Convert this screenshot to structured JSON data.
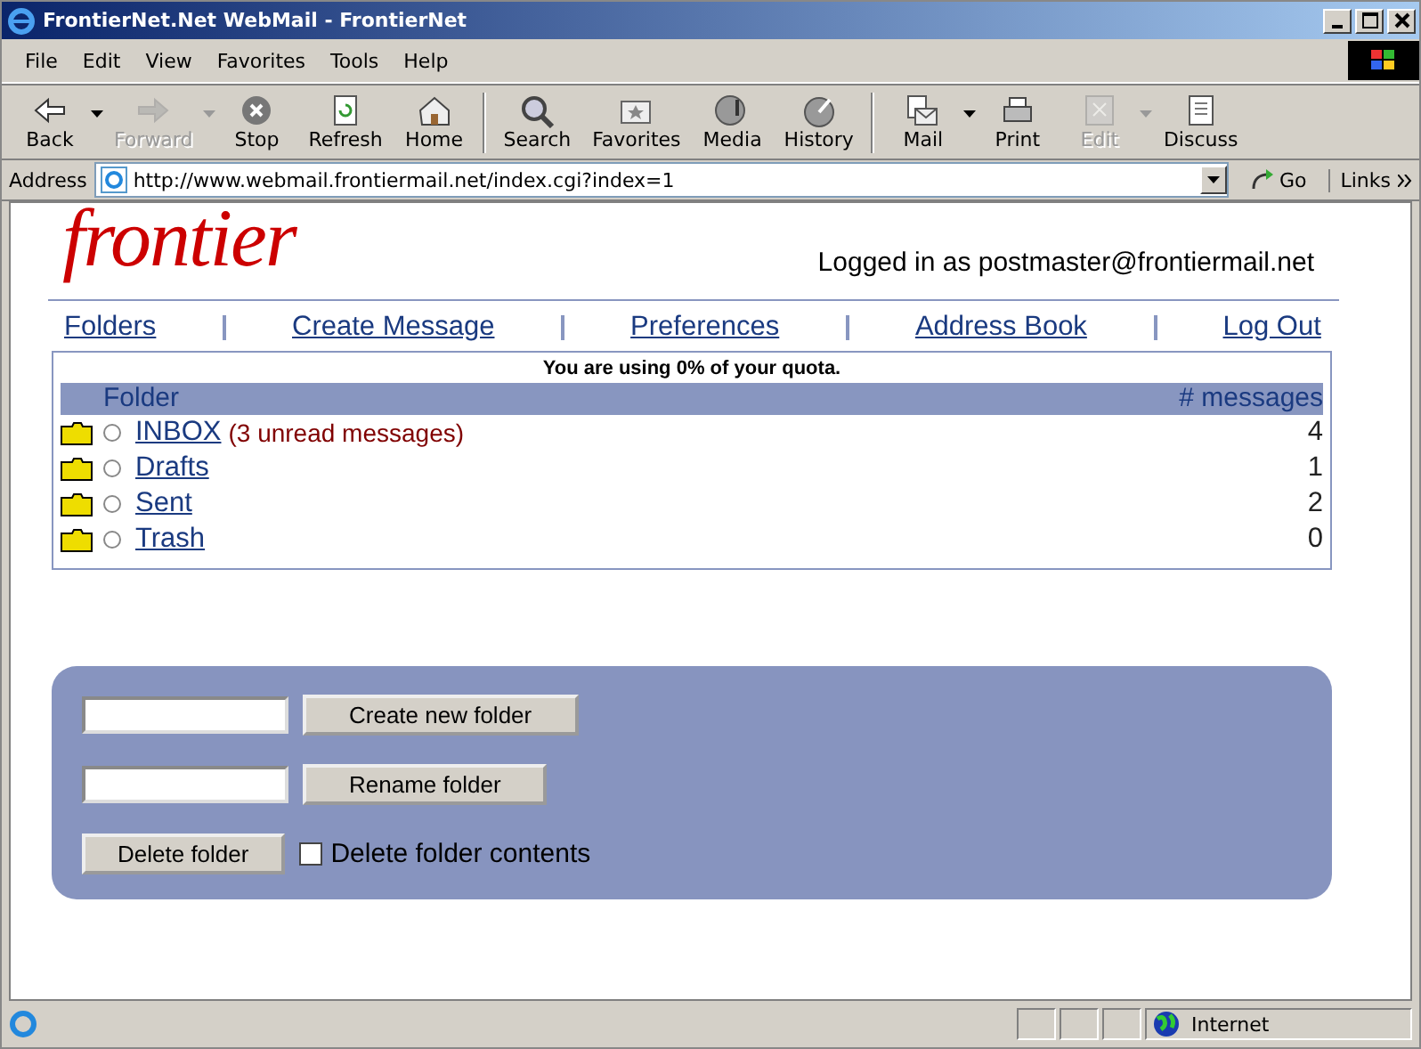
{
  "window": {
    "title": "FrontierNet.Net WebMail - FrontierNet"
  },
  "menu": [
    "File",
    "Edit",
    "View",
    "Favorites",
    "Tools",
    "Help"
  ],
  "toolbar": [
    [
      {
        "label": "Back",
        "disabled": false,
        "dropdown": true
      },
      {
        "label": "Forward",
        "disabled": true,
        "dropdown": true
      },
      {
        "label": "Stop",
        "disabled": false,
        "dropdown": false
      },
      {
        "label": "Refresh",
        "disabled": false,
        "dropdown": false
      },
      {
        "label": "Home",
        "disabled": false,
        "dropdown": false
      }
    ],
    [
      {
        "label": "Search",
        "disabled": false,
        "dropdown": false
      },
      {
        "label": "Favorites",
        "disabled": false,
        "dropdown": false
      },
      {
        "label": "Media",
        "disabled": false,
        "dropdown": false
      },
      {
        "label": "History",
        "disabled": false,
        "dropdown": false
      }
    ],
    [
      {
        "label": "Mail",
        "disabled": false,
        "dropdown": true
      },
      {
        "label": "Print",
        "disabled": false,
        "dropdown": false
      },
      {
        "label": "Edit",
        "disabled": true,
        "dropdown": true
      },
      {
        "label": "Discuss",
        "disabled": false,
        "dropdown": false
      }
    ]
  ],
  "address_bar": {
    "label": "Address",
    "url": "http://www.webmail.frontiermail.net/index.cgi?index=1",
    "go": "Go",
    "links": "Links"
  },
  "page": {
    "logo": "frontier",
    "logged_in": "Logged in as postmaster@frontiermail.net",
    "nav": [
      "Folders",
      "Create Message",
      "Preferences",
      "Address Book",
      "Log Out"
    ],
    "quota": "You are using 0% of your quota.",
    "table": {
      "columns": [
        "Folder",
        "# messages"
      ],
      "rows": [
        {
          "name": "INBOX",
          "note": "(3 unread messages)",
          "count": "4",
          "selected": false
        },
        {
          "name": "Drafts",
          "count": "1",
          "selected": false
        },
        {
          "name": "Sent",
          "count": "2",
          "selected": false
        },
        {
          "name": "Trash",
          "count": "0",
          "selected": false
        }
      ]
    },
    "actions": {
      "create_button": "Create new folder",
      "rename_button": "Rename folder",
      "delete_button": "Delete folder",
      "delete_contents": {
        "label": "Delete folder contents",
        "checked": false
      }
    }
  },
  "status_bar": {
    "zone": "Internet"
  }
}
